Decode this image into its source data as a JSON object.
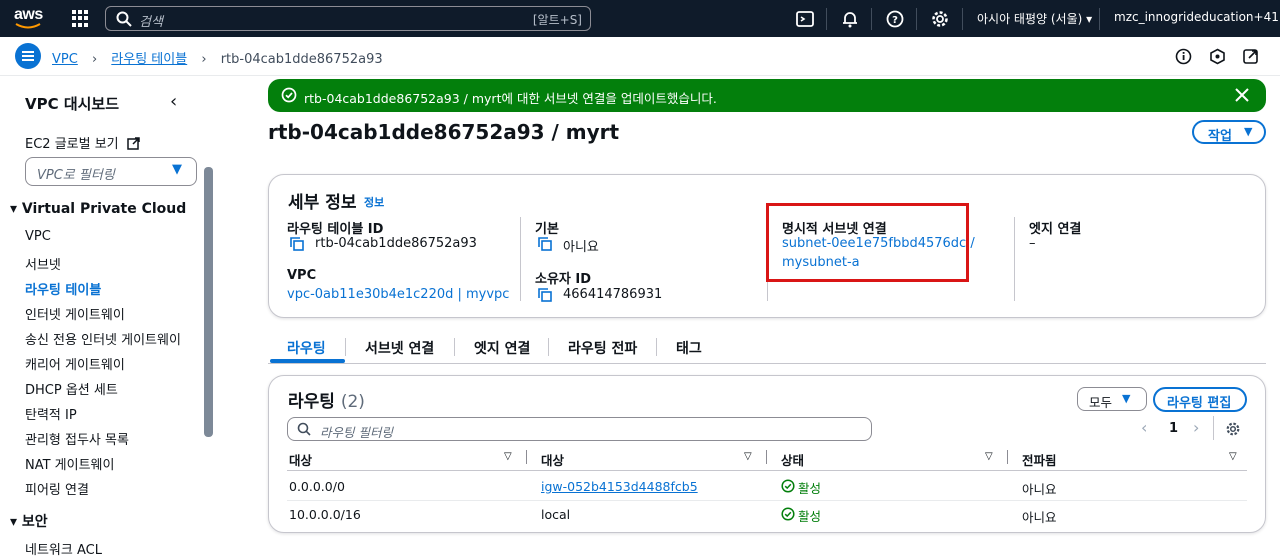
{
  "topnav": {
    "logo": "aws",
    "search_placeholder": "검색",
    "search_shortcut": "[알트+S]",
    "region": "아시아 태평양 (서울)",
    "account": "mzc_innogrideducation+41"
  },
  "breadcrumb": {
    "items": [
      "VPC",
      "라우팅 테이블"
    ],
    "current": "rtb-04cab1dde86752a93"
  },
  "sidebar": {
    "title": "VPC 대시보드",
    "ec2_link": "EC2 글로벌 보기",
    "filter_placeholder": "VPC로 필터링",
    "section1": "Virtual Private Cloud",
    "items": [
      "VPC",
      "서브넷",
      "라우팅 테이블",
      "인터넷 게이트웨이",
      "송신 전용 인터넷 게이트웨이",
      "캐리어 게이트웨이",
      "DHCP 옵션 세트",
      "탄력적 IP",
      "관리형 접두사 목록",
      "NAT 게이트웨이",
      "피어링 연결"
    ],
    "active_index": 2,
    "section2": "보안",
    "section2_items": [
      "네트워크 ACL"
    ]
  },
  "flash": {
    "message": "rtb-04cab1dde86752a93 / myrt에 대한 서브넷 연결을 업데이트했습니다.",
    "color": "#037f0c"
  },
  "page": {
    "title": "rtb-04cab1dde86752a93 / myrt",
    "actions_label": "작업"
  },
  "details": {
    "heading": "세부 정보",
    "info_link": "정보",
    "rt_id_label": "라우팅 테이블 ID",
    "rt_id_value": "rtb-04cab1dde86752a93",
    "vpc_label": "VPC",
    "vpc_value": "vpc-0ab11e30b4e1c220d | myvpc",
    "main_label": "기본",
    "main_value": "아니요",
    "owner_label": "소유자 ID",
    "owner_value": "466414786931",
    "explicit_label": "명시적 서브넷 연결",
    "explicit_value_1": "subnet-0ee1e75fbbd4576dc /",
    "explicit_value_2": "mysubnet-a",
    "edge_label": "엣지 연결",
    "edge_value": "–",
    "highlight_color": "#d91515"
  },
  "tabs": [
    "라우팅",
    "서브넷 연결",
    "엣지 연결",
    "라우팅 전파",
    "태그"
  ],
  "routes": {
    "heading": "라우팅",
    "count": "(2)",
    "filter_dropdown": "모두",
    "edit_button": "라우팅 편집",
    "filter_placeholder": "라우팅 필터링",
    "page_number": "1",
    "columns": [
      "대상",
      "대상",
      "상태",
      "전파됨"
    ],
    "rows": [
      {
        "destination": "0.0.0.0/0",
        "target": "igw-052b4153d4488fcb5",
        "status": "활성",
        "propagated": "아니요"
      },
      {
        "destination": "10.0.0.0/16",
        "target": "local",
        "status": "활성",
        "propagated": "아니요"
      }
    ],
    "status_color": "#037f0c"
  }
}
